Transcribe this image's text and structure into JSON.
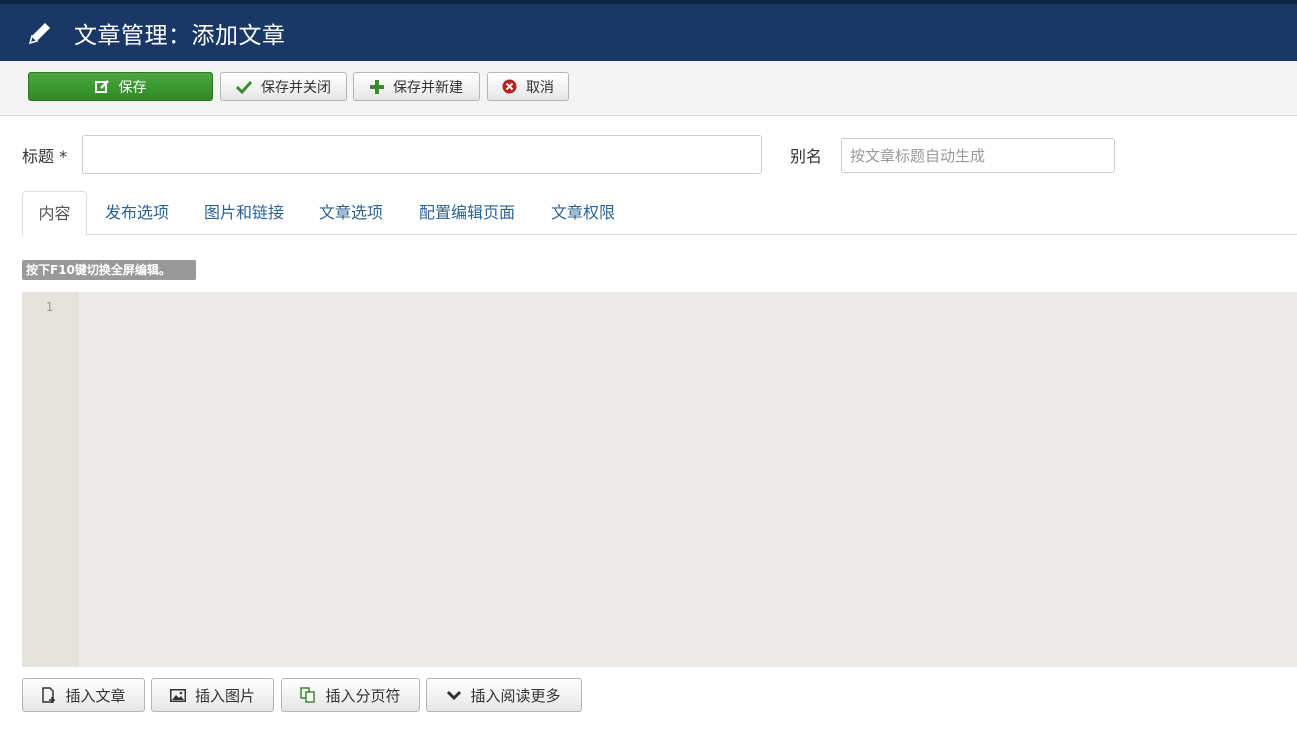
{
  "header": {
    "title": "文章管理：添加文章",
    "icon": "pencil-icon"
  },
  "toolbar": {
    "save": "保存",
    "save_close": "保存并关闭",
    "save_new": "保存并新建",
    "cancel": "取消"
  },
  "form": {
    "title_label": "标题 *",
    "title_value": "",
    "alias_label": "别名",
    "alias_placeholder": "按文章标题自动生成"
  },
  "tabs": [
    "内容",
    "发布选项",
    "图片和链接",
    "文章选项",
    "配置编辑页面",
    "文章权限"
  ],
  "editor": {
    "hint": "按下F10键切换全屏编辑。",
    "line_number": "1"
  },
  "bottom_buttons": {
    "insert_article": "插入文章",
    "insert_image": "插入图片",
    "insert_pagebreak": "插入分页符",
    "insert_readmore": "插入阅读更多"
  },
  "colors": {
    "header_bg": "#1a3867",
    "save_button": "#2d8a26",
    "tab_link": "#2a6496",
    "editor_bg": "#ebeae7"
  }
}
